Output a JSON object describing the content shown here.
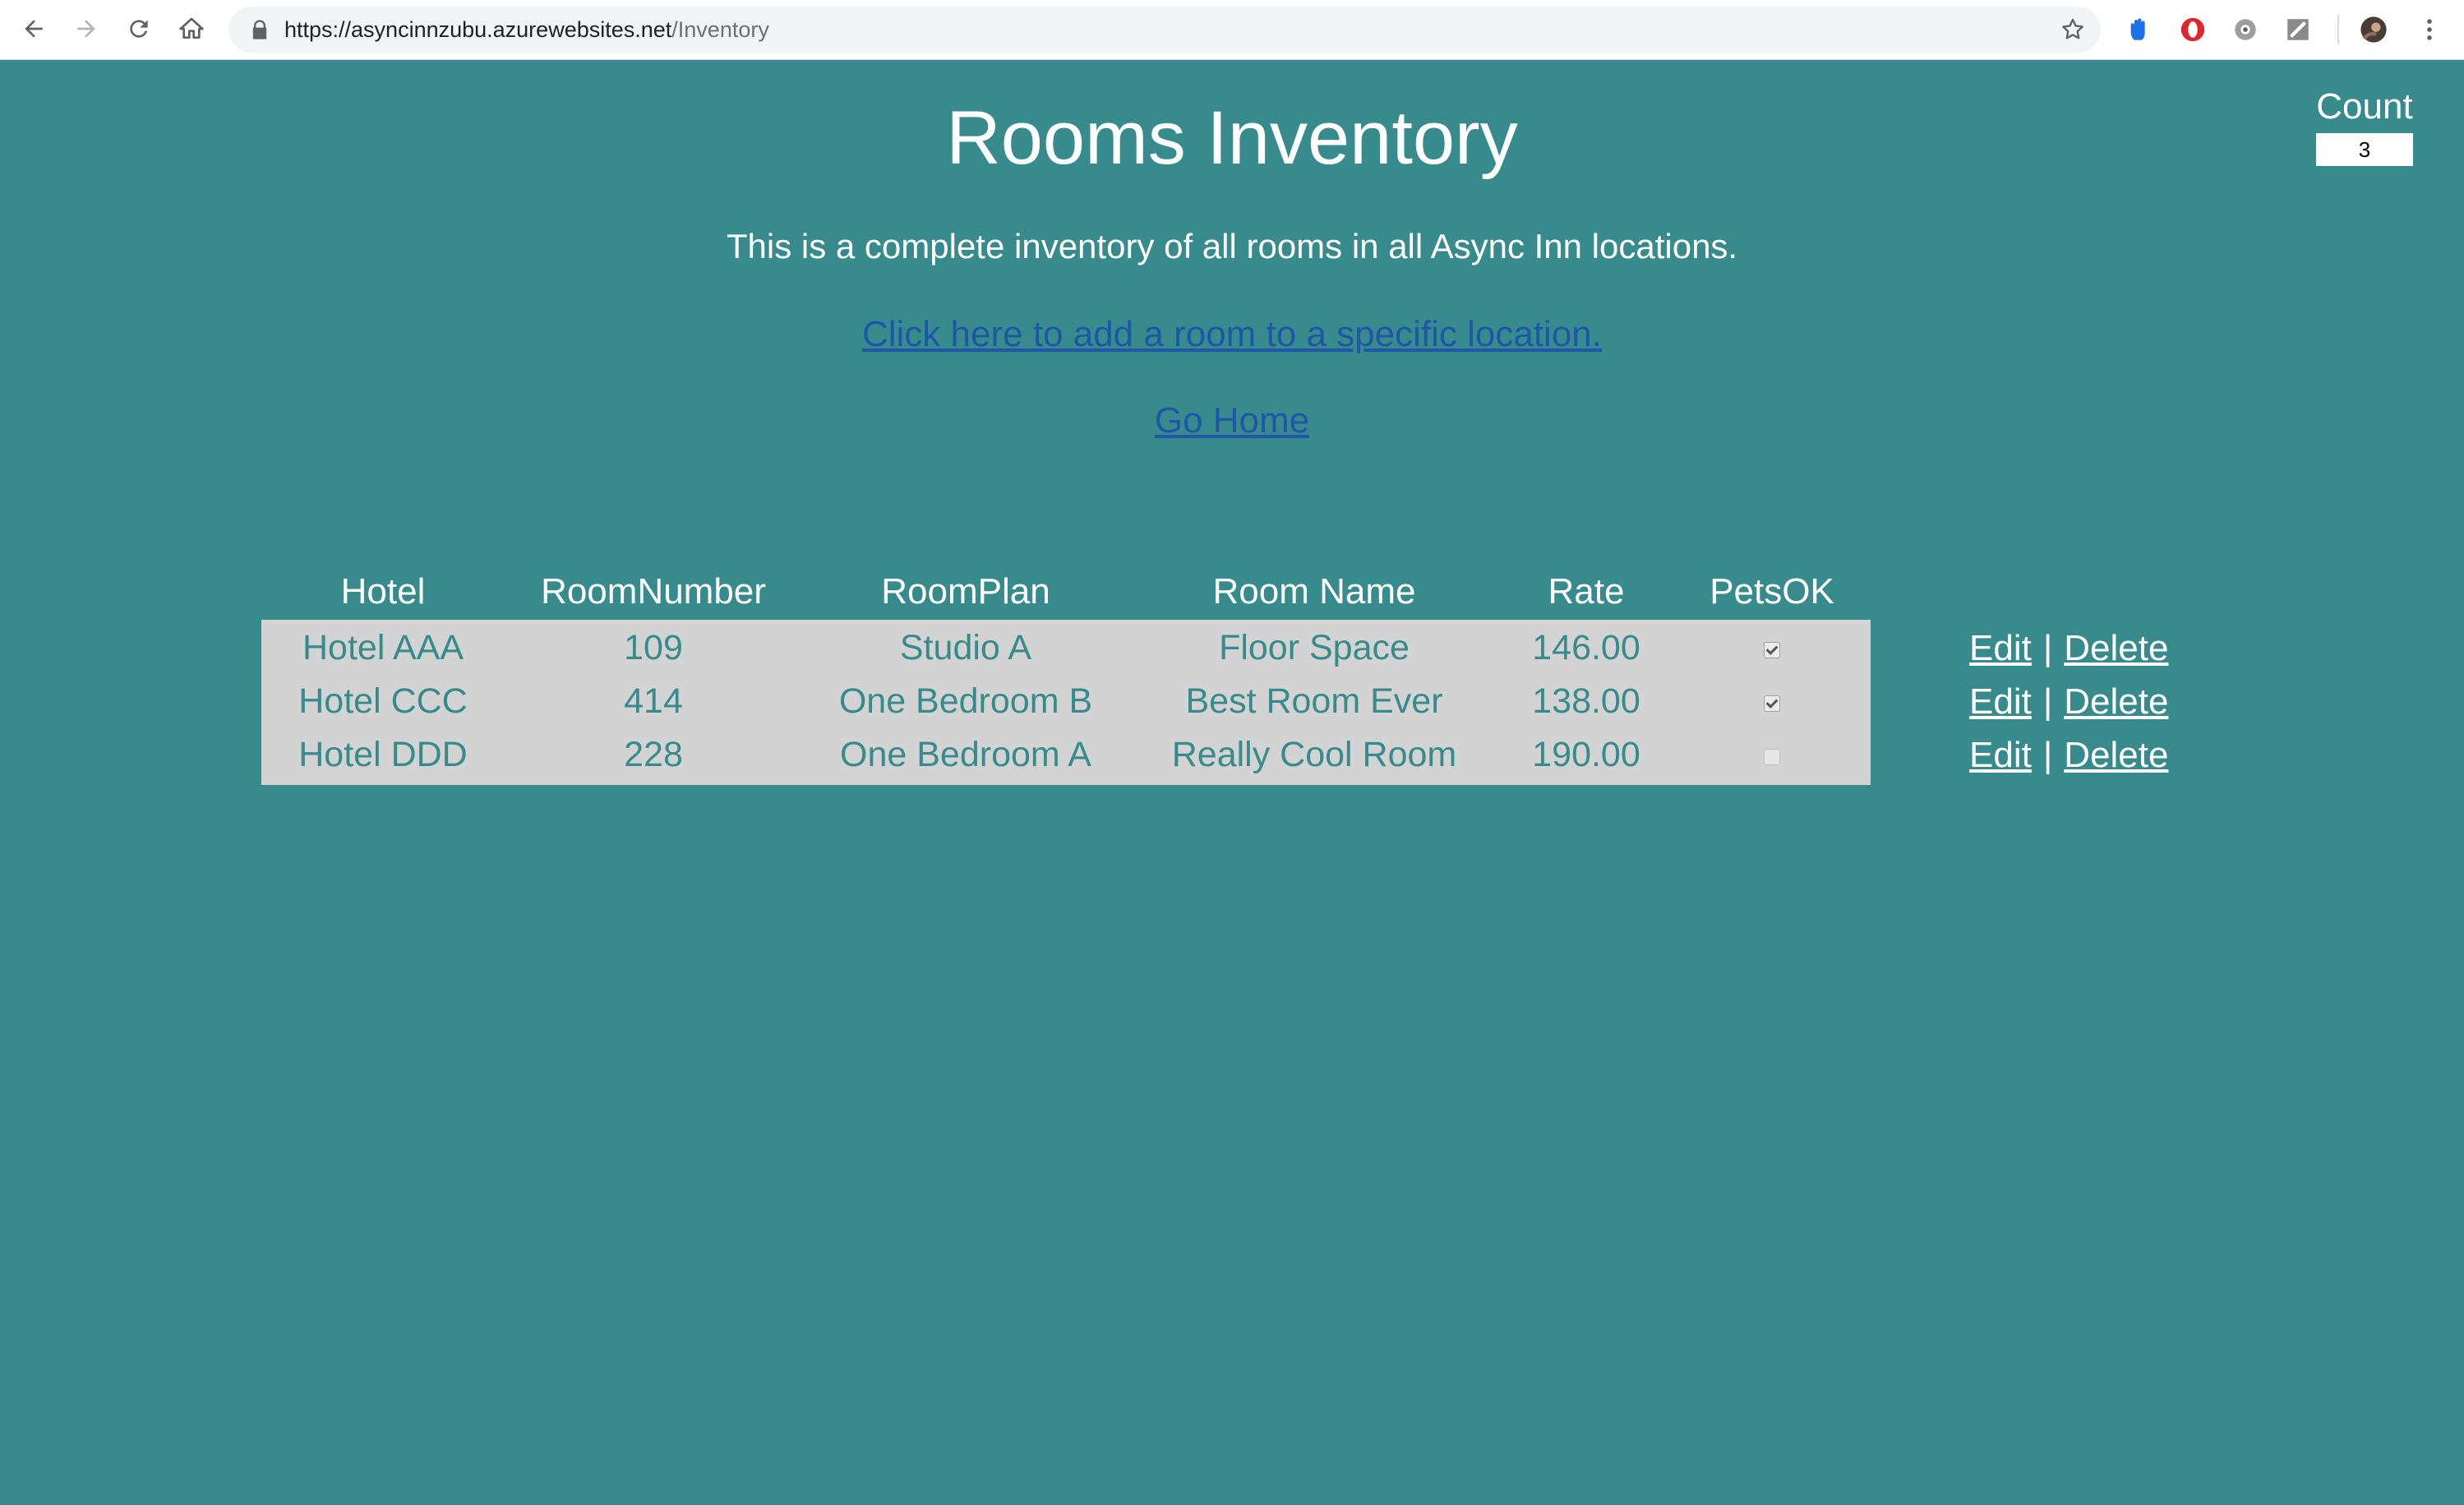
{
  "browser": {
    "url_host": "https://asyncinnzubu.azurewebsites.net",
    "url_path": "/Inventory"
  },
  "page": {
    "title": "Rooms Inventory",
    "subtitle": "This is a complete inventory of all rooms in all Async Inn locations.",
    "add_link": "Click here to add a room to a specific location.",
    "home_link": "Go Home",
    "count_label": "Count",
    "count_value": "3"
  },
  "table": {
    "headers": [
      "Hotel",
      "RoomNumber",
      "RoomPlan",
      "Room Name",
      "Rate",
      "PetsOK"
    ],
    "rows": [
      {
        "hotel": "Hotel AAA",
        "room_number": "109",
        "room_plan": "Studio A",
        "room_name": "Floor Space",
        "rate": "146.00",
        "pets_ok": true,
        "edit": "Edit",
        "sep": "|",
        "delete": "Delete"
      },
      {
        "hotel": "Hotel CCC",
        "room_number": "414",
        "room_plan": "One Bedroom B",
        "room_name": "Best Room Ever",
        "rate": "138.00",
        "pets_ok": true,
        "edit": "Edit",
        "sep": "|",
        "delete": "Delete"
      },
      {
        "hotel": "Hotel DDD",
        "room_number": "228",
        "room_plan": "One Bedroom A",
        "room_name": "Really Cool Room",
        "rate": "190.00",
        "pets_ok": false,
        "edit": "Edit",
        "sep": "|",
        "delete": "Delete"
      }
    ]
  },
  "colors": {
    "background": "#378b8c",
    "row_background": "#d3d3d3",
    "link": "#1f57a8"
  }
}
